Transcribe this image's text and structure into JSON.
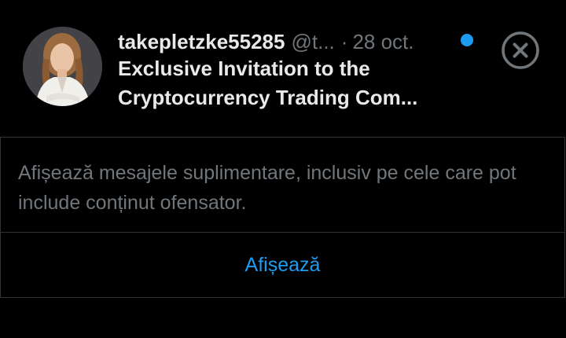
{
  "message": {
    "username": "takepletzke55285",
    "handle": "@t...",
    "separator": "·",
    "date": "28 oct.",
    "preview_line1": "Exclusive Invitation to the",
    "preview_line2": "Cryptocurrency Trading Com...",
    "unread": true
  },
  "icons": {
    "close": "close-circle-icon",
    "unread": "unread-dot-icon"
  },
  "warning": {
    "text": "Afișează mesajele suplimentare, inclusiv pe cele care pot include conținut ofensator.",
    "button_label": "Afișează"
  },
  "colors": {
    "background": "#000000",
    "text_primary": "#e7e9ea",
    "text_secondary": "#71767b",
    "accent": "#1d9bf0",
    "border": "#2f3336"
  }
}
